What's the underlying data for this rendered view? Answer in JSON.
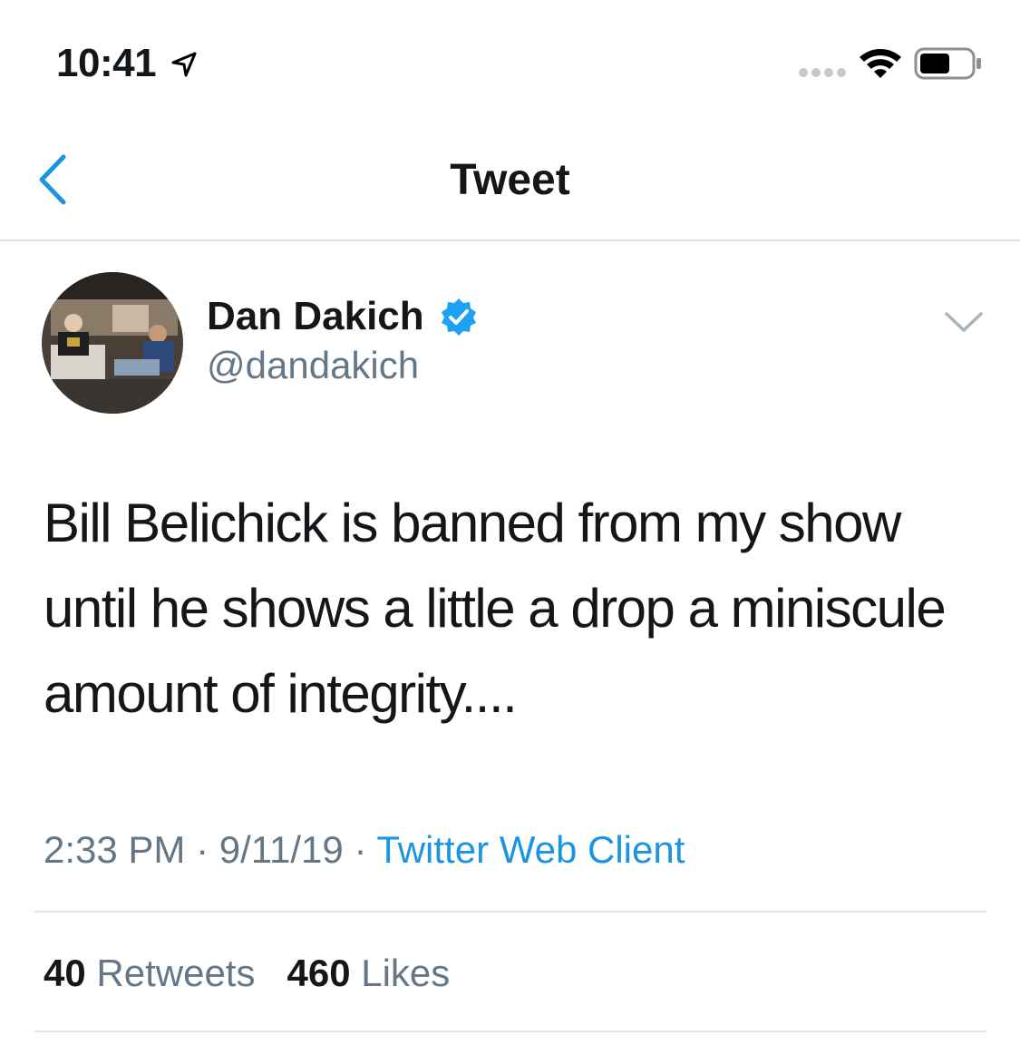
{
  "status_bar": {
    "time": "10:41",
    "location_icon": "location-arrow-icon",
    "signal_icon": "cellular-dots-icon",
    "wifi_icon": "wifi-icon",
    "battery_icon": "battery-icon"
  },
  "nav": {
    "back_icon": "chevron-left-icon",
    "title": "Tweet"
  },
  "author": {
    "display_name": "Dan Dakich",
    "handle": "@dandakich",
    "verified_icon": "verified-badge-icon",
    "more_icon": "chevron-down-icon"
  },
  "tweet": {
    "text": "Bill Belichick is banned from my show until he shows a little a drop a miniscule amount of integrity....",
    "time": "2:33 PM",
    "date": "9/11/19",
    "separator": "·",
    "source": "Twitter Web Client"
  },
  "stats": {
    "retweets_count": "40",
    "retweets_label": "Retweets",
    "likes_count": "460",
    "likes_label": "Likes"
  },
  "colors": {
    "link": "#1b95e0",
    "secondary_text": "#657786",
    "primary_text": "#14171a",
    "verified": "#1da1f2"
  }
}
